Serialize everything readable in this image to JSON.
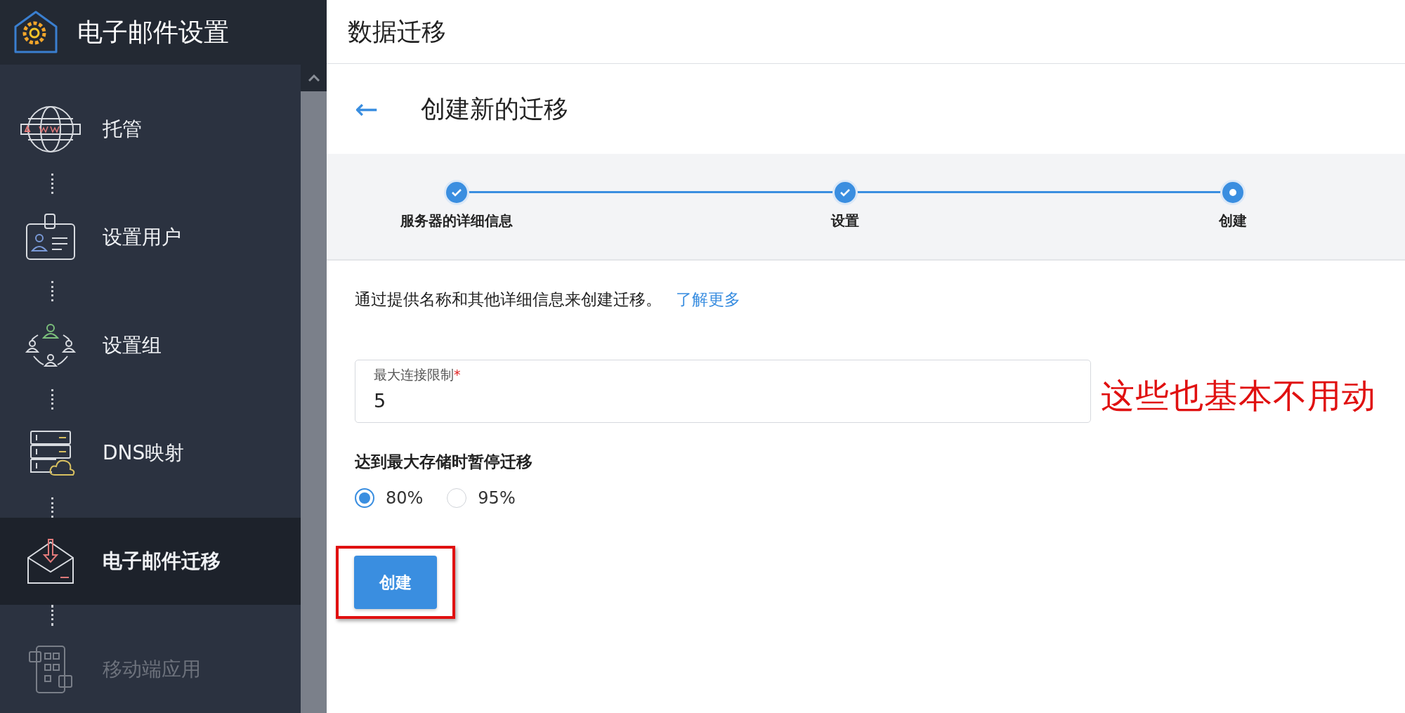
{
  "sidebar": {
    "title": "电子邮件设置",
    "items": [
      {
        "label": "托管",
        "selected": false,
        "disabled": false
      },
      {
        "label": "设置用户",
        "selected": false,
        "disabled": false
      },
      {
        "label": "设置组",
        "selected": false,
        "disabled": false
      },
      {
        "label": "DNS映射",
        "selected": false,
        "disabled": false
      },
      {
        "label": "电子邮件迁移",
        "selected": true,
        "disabled": false
      },
      {
        "label": "移动端应用",
        "selected": false,
        "disabled": true
      }
    ]
  },
  "header": {
    "title": "数据迁移"
  },
  "page": {
    "back": "←",
    "title": "创建新的迁移"
  },
  "steps": [
    {
      "label": "服务器的详细信息",
      "done": true
    },
    {
      "label": "设置",
      "done": true
    },
    {
      "label": "创建",
      "done": false
    }
  ],
  "description": {
    "text": "通过提供名称和其他详细信息来创建迁移。",
    "link": "了解更多"
  },
  "field": {
    "label": "最大连接限制",
    "required_mark": "*",
    "value": "5"
  },
  "pause": {
    "label": "达到最大存储时暂停迁移",
    "options": [
      {
        "label": "80%",
        "selected": true
      },
      {
        "label": "95%",
        "selected": false
      }
    ]
  },
  "create_button": {
    "label": "创建",
    "highlighted": true
  },
  "annotation": "这些也基本不用动"
}
